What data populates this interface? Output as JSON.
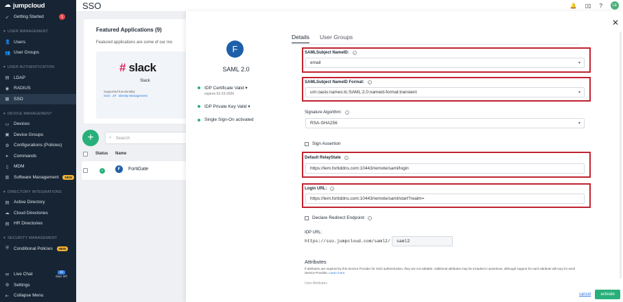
{
  "brand": {
    "name": "jumpcloud"
  },
  "sidebar": {
    "top": [
      {
        "label": "Getting Started",
        "badge": "1"
      }
    ],
    "sections": [
      {
        "title": "USER MANAGEMENT",
        "items": [
          {
            "label": "Users"
          },
          {
            "label": "User Groups"
          }
        ]
      },
      {
        "title": "USER AUTHENTICATION",
        "items": [
          {
            "label": "LDAP"
          },
          {
            "label": "RADIUS"
          },
          {
            "label": "SSO",
            "active": true
          }
        ]
      },
      {
        "title": "DEVICE MANAGEMENT",
        "items": [
          {
            "label": "Devices"
          },
          {
            "label": "Device Groups"
          },
          {
            "label": "Configurations (Policies)"
          },
          {
            "label": "Commands"
          },
          {
            "label": "MDM"
          },
          {
            "label": "Software Management",
            "badge": "NEW"
          }
        ]
      },
      {
        "title": "DIRECTORY INTEGRATIONS",
        "items": [
          {
            "label": "Active Directory"
          },
          {
            "label": "Cloud Directories"
          },
          {
            "label": "HR Directories"
          }
        ]
      },
      {
        "title": "SECURITY MANAGEMENT",
        "items": [
          {
            "label": "Conditional Policies",
            "badge": "NEW"
          }
        ]
      }
    ],
    "bottom": {
      "live_chat": "Live Chat",
      "days_num": "10",
      "days_label": "days left",
      "settings": "Settings",
      "collapse": "Collapse Menu"
    }
  },
  "topbar": {
    "title": "SSO",
    "avatar": "LE"
  },
  "featured": {
    "title": "Featured Applications (9)",
    "desc": "Featured applications are some of our mo",
    "card": {
      "logo_text": "slack",
      "name": "Slack",
      "supported": "Supported functionality",
      "tags": [
        "SSO",
        "JIT",
        "Identity Management"
      ]
    }
  },
  "list": {
    "search_placeholder": "Search",
    "col_status": "Status",
    "col_name": "Name",
    "row_name": "FortiGate"
  },
  "panel": {
    "app_initial": "F",
    "app_name": "SAML 2.0",
    "status": {
      "idp_cert": "IDP Certificate Valid",
      "idp_cert_sub": "expires 02-23-2026",
      "idp_key": "IDP Private Key Valid",
      "sso": "Single Sign-On activated"
    },
    "tabs": [
      "Details",
      "User Groups"
    ],
    "fields": {
      "nameid_label": "SAMLSubject NameID:",
      "nameid_value": "email",
      "nameid_format_label": "SAMLSubject NameID Format:",
      "nameid_format_value": "urn:oasis:names:tc:SAML:2.0:nameid-format:transient",
      "sig_label": "Signature Algorithm:",
      "sig_value": "RSA-SHA256",
      "sign_assertion": "Sign Assertion",
      "relay_label": "Default RelayState",
      "relay_value": "https://lem.fortiddns.com:10443/remote/saml/login",
      "login_label": "Login URL:",
      "login_value": "https://lem.fortiddns.com:10443/remote/saml/start?realm=",
      "declare_redirect": "Declare Redirect Endpoint",
      "idp_url_label": "IDP URL:",
      "idp_url_prefix": "https://sso.jumpcloud.com/saml2/",
      "idp_url_value": "saml2",
      "attributes_title": "Attributes",
      "attributes_desc": "If attributes are required by this Service Provider for SSO authentication, they are not editable. Additional attributes may be included in assertions, although support for each attribute will vary for each Service Provider.",
      "learn_more": "Learn more.",
      "user_attributes": "User Attributes"
    },
    "footer": {
      "cancel": "cancel",
      "activate": "activate"
    }
  }
}
